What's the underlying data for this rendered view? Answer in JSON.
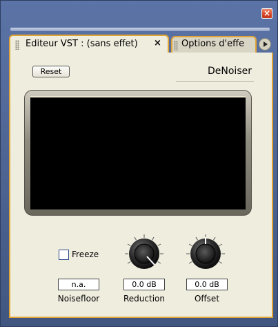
{
  "window": {
    "close_glyph": "×"
  },
  "tabs": [
    {
      "label": "Editeur VST : (sans effet)",
      "close_glyph": "×",
      "active": true
    },
    {
      "label": "Options d'effe",
      "active": false
    }
  ],
  "panel": {
    "reset_label": "Reset",
    "plugin_name": "DeNoiser",
    "freeze_label": "Freeze",
    "freeze_checked": false
  },
  "controls": {
    "noisefloor": {
      "value": "n.a.",
      "label": "Noisefloor"
    },
    "reduction": {
      "value": "0.0 dB",
      "label": "Reduction"
    },
    "offset": {
      "value": "0.0 dB",
      "label": "Offset"
    }
  },
  "colors": {
    "window_bg": "#4a5f8c",
    "panel_bg": "#efedde",
    "tab_border": "#e0a436",
    "close_btn": "#d9482a",
    "display_bg": "#000000"
  }
}
